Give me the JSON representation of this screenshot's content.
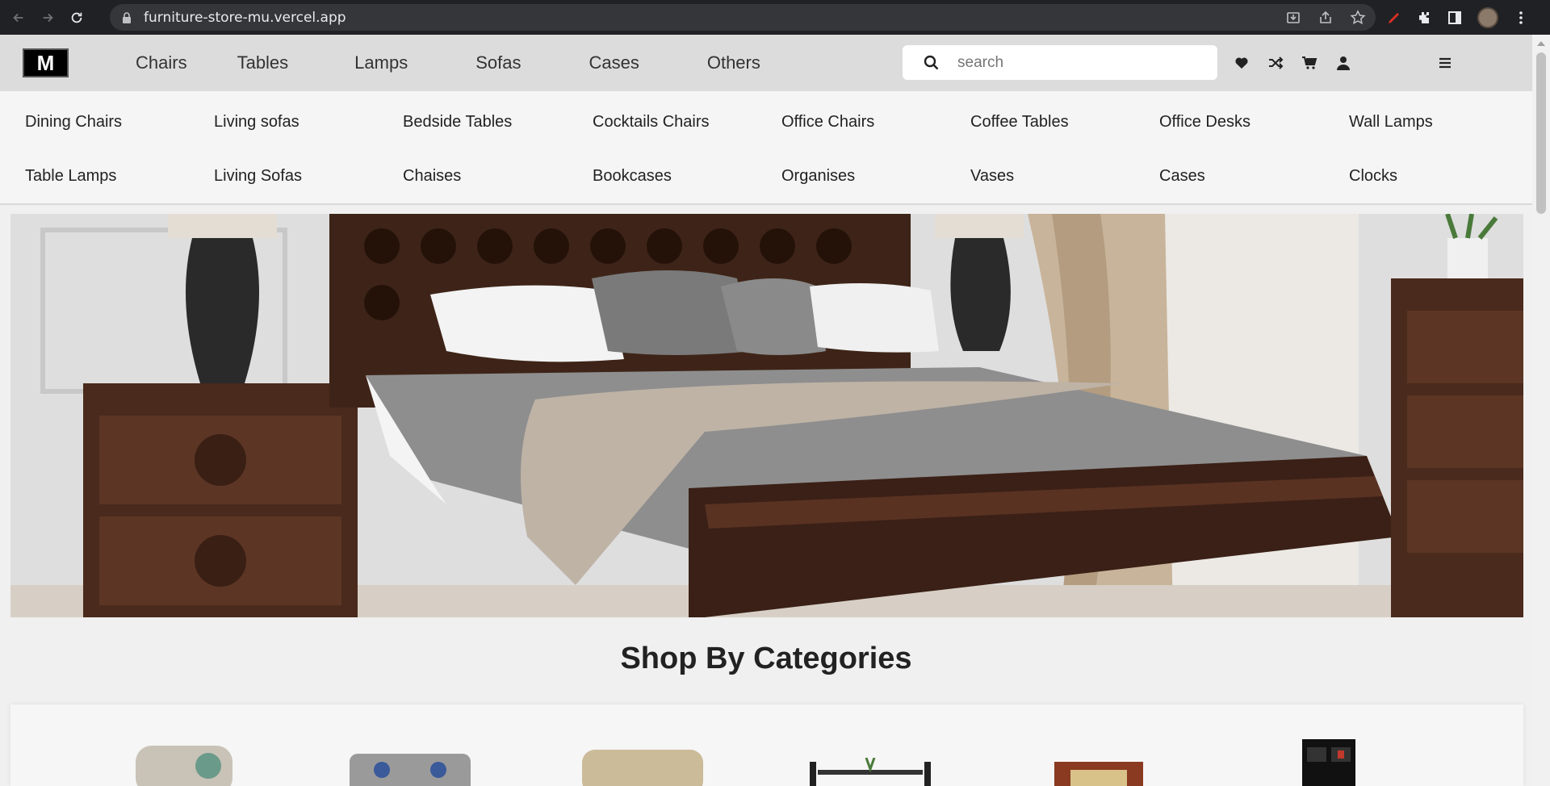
{
  "browser": {
    "url": "furniture-store-mu.vercel.app"
  },
  "header": {
    "logo": "M",
    "nav": [
      "Chairs",
      "Tables",
      "Lamps",
      "Sofas",
      "Cases",
      "Others"
    ],
    "search_placeholder": "search"
  },
  "submenu": {
    "row1": [
      "Dining Chairs",
      "Living sofas",
      "Bedside Tables",
      "Cocktails Chairs",
      "Office Chairs",
      "Coffee Tables",
      "Office Desks",
      "Wall Lamps"
    ],
    "row2": [
      "Table Lamps",
      "Living Sofas",
      "Chaises",
      "Bookcases",
      "Organises",
      "Vases",
      "Cases",
      "Clocks"
    ]
  },
  "sections": {
    "categories_title": "Shop By Categories"
  },
  "colors": {
    "header_bg": "#dcdcdc",
    "page_bg": "#f0f0f0",
    "chrome_bg": "#202124"
  }
}
